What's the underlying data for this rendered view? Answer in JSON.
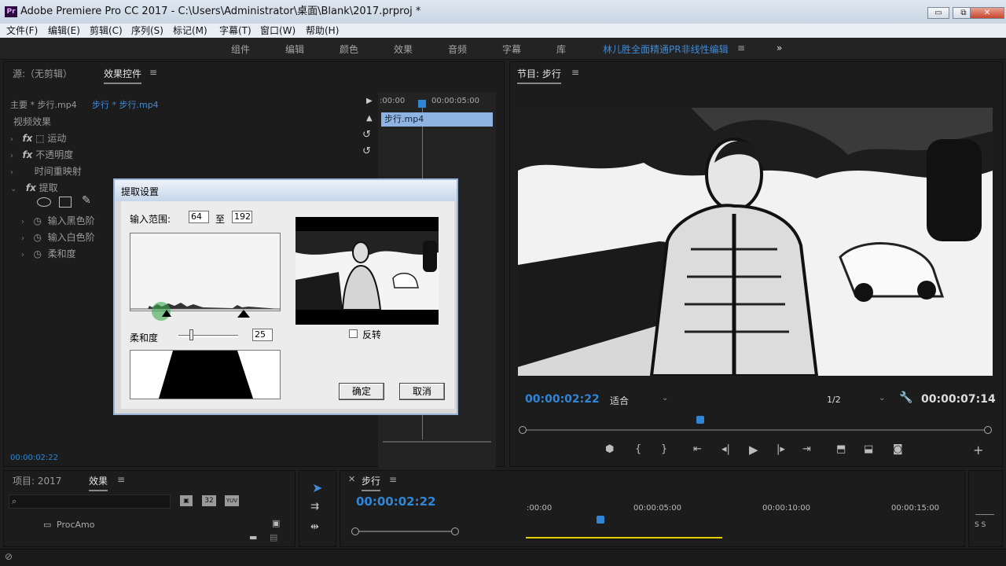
{
  "titlebar": {
    "logo": "Pr",
    "title": "Adobe Premiere Pro CC 2017 - C:\\Users\\Administrator\\桌面\\Blank\\2017.prproj *",
    "min": "▭",
    "restore": "⧉",
    "close": "✕"
  },
  "menu": [
    "文件(F)",
    "编辑(E)",
    "剪辑(C)",
    "序列(S)",
    "标记(M)",
    "字幕(T)",
    "窗口(W)",
    "帮助(H)"
  ],
  "workspaces": {
    "items": [
      "组件",
      "编辑",
      "颜色",
      "效果",
      "音频",
      "字幕",
      "库"
    ],
    "active": "林儿胜全面精通PR非线性编辑",
    "menu_icon": "≡",
    "overflow": "»"
  },
  "source_panel": {
    "tab_source": "源:（无剪辑）",
    "tab_effect_controls": "效果控件",
    "menu_icon": "≡",
    "master": "主要 * 步行.mp4",
    "sequence_clip": "步行 * 步行.mp4",
    "section": "视频效果",
    "effects": [
      {
        "fx": "fx",
        "label": "运动"
      },
      {
        "fx": "fx",
        "label": "不透明度"
      },
      {
        "fx": "",
        "label": "时间重映射"
      },
      {
        "fx": "fx",
        "label": "提取"
      }
    ],
    "params": [
      "输入黑色阶",
      "输入白色阶",
      "柔和度"
    ],
    "mini_timeline": {
      "t0": ":00:00",
      "t1": "00:00:05:00",
      "clip": "步行.mp4"
    },
    "timecode": "00:00:02:22"
  },
  "program_monitor": {
    "title": "节目: 步行",
    "menu_icon": "≡",
    "timecode_current": "00:00:02:22",
    "fit": "适合",
    "resolution": "1/2",
    "timecode_duration": "00:00:07:14",
    "playhead_position": 0.38
  },
  "project_panel": {
    "tab_project": "项目: 2017",
    "tab_effects": "效果",
    "menu_icon": "≡",
    "search_placeholder": "",
    "folder": "ProcAmo",
    "btn_32": "32",
    "btn_yuv": "YUV"
  },
  "timeline": {
    "title": "步行",
    "menu_icon": "≡",
    "timecode": "00:00:02:22",
    "ruler": [
      ":00:00",
      "00:00:05:00",
      "00:00:10:00",
      "00:00:15:00"
    ],
    "meter_label": "S S"
  },
  "dialog": {
    "title": "提取设置",
    "input_range_label": "输入范围:",
    "black_value": "64",
    "to_label": "至",
    "white_value": "192",
    "softness_label": "柔和度",
    "softness_value": "25",
    "invert_label": "反转",
    "invert_checked": false,
    "ok": "确定",
    "cancel": "取消"
  }
}
